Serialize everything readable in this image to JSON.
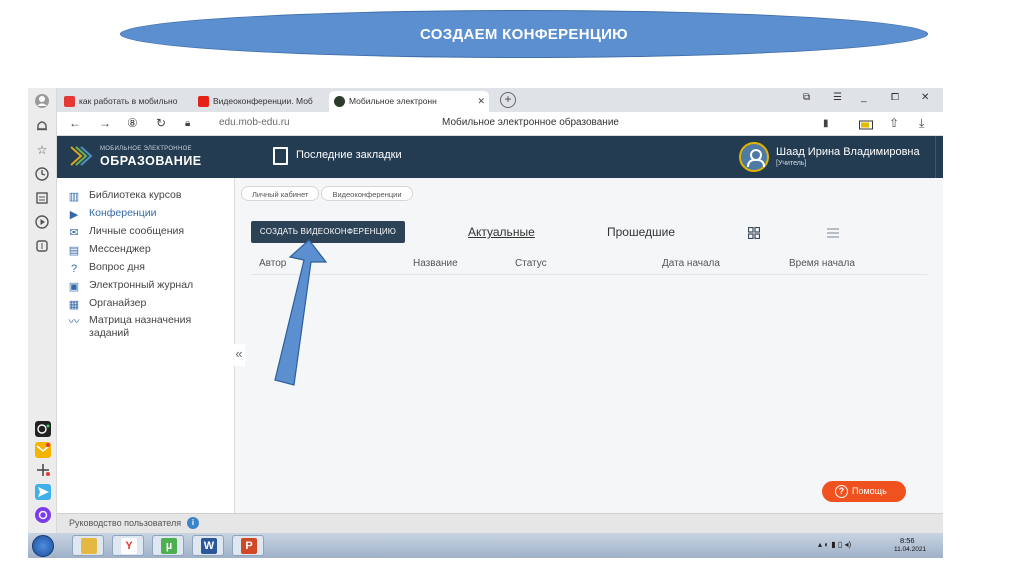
{
  "slide": {
    "title": "СОЗДАЕМ КОНФЕРЕНЦИЮ"
  },
  "browser": {
    "tabs": [
      {
        "label": "как работать в мобильно",
        "favicon_color": "#e53935"
      },
      {
        "label": "Видеоконференции. Моб",
        "favicon_color": "#e62117"
      },
      {
        "label": "Мобильное электронн",
        "favicon_color": "#2d3b2d",
        "active": true
      }
    ],
    "url": "edu.mob-edu.ru",
    "page_title": "Мобильное электронное образование"
  },
  "header": {
    "logo_top": "МОБИЛЬНОЕ ЭЛЕКТРОННОЕ",
    "logo_main": "ОБРАЗОВАНИЕ",
    "bookmarks_label": "Последние закладки",
    "user_name": "Шаад Ирина Владимировна",
    "user_role": "[Учитель]"
  },
  "sidebar": {
    "items": [
      {
        "label": "Библиотека курсов",
        "icon": "books-icon"
      },
      {
        "label": "Конференции",
        "icon": "video-icon",
        "active": true
      },
      {
        "label": "Личные сообщения",
        "icon": "mail-icon"
      },
      {
        "label": "Мессенджер",
        "icon": "chat-icon"
      },
      {
        "label": "Вопрос дня",
        "icon": "question-icon"
      },
      {
        "label": "Электронный журнал",
        "icon": "journal-icon"
      },
      {
        "label": "Органайзер",
        "icon": "calendar-icon"
      },
      {
        "label": "Матрица назначения",
        "label2": "заданий",
        "icon": "trend-icon"
      }
    ]
  },
  "content": {
    "breadcrumbs": [
      "Личный кабинет",
      "Видеоконференции"
    ],
    "create_button": "СОЗДАТЬ ВИДЕОКОНФЕРЕНЦИЮ",
    "tab_current": "Актуальные",
    "tab_past": "Прошедшие",
    "columns": [
      "Автор",
      "Название",
      "Статус",
      "Дата начала",
      "Время начала"
    ],
    "help_button": "Помощь"
  },
  "footer": {
    "text": "Руководство пользователя"
  },
  "taskbar": {
    "time": "8:56",
    "date": "11.04.2021"
  },
  "colors": {
    "title_ellipse": "#5b8fd0",
    "header": "#243c52",
    "accent": "#3569a8",
    "help": "#f0521f",
    "arrow": "#5b8fd0"
  }
}
